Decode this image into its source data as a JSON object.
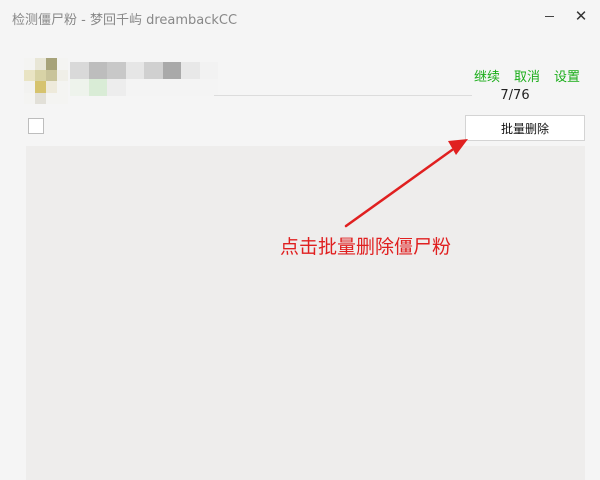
{
  "window": {
    "title": "检测僵尸粉 - 梦回千屿 dreambackCC",
    "close_glyph": "✕"
  },
  "profile": {
    "avatar_colors": [
      "#f4f4f2",
      "#e8e6d6",
      "#a7a37a",
      "#f4f4f2",
      "#e9e4c4",
      "#d8d3a6",
      "#c9c49a",
      "#f0efe8",
      "#f2f2f0",
      "#d6c36e",
      "#eeeadb",
      "#f4f4f2",
      "#f4f4f2",
      "#e2e0d8",
      "#f4f4f2",
      "#f4f4f2"
    ],
    "name_colors": [
      "#d9d9d9",
      "#bdbdbd",
      "#c8c8c8",
      "#e6e6e6",
      "#d0d0d0",
      "#a9a9a9",
      "#e8e8e8",
      "#f2f2f2",
      "#eef3ec",
      "#d9ecd6",
      "#ededed",
      "#f4f4f4",
      "#f4f4f4",
      "#f4f4f4",
      "#f4f4f4",
      "#f4f4f4"
    ]
  },
  "actions": {
    "continue_label": "继续",
    "cancel_label": "取消",
    "settings_label": "设置",
    "link_color": "#1aad19"
  },
  "progress": {
    "text": "7/76",
    "current": 7,
    "total": 76
  },
  "toolbar": {
    "bulk_delete_label": "批量删除",
    "select_all_checked": false
  },
  "annotation": {
    "text": "点击批量删除僵尸粉",
    "color": "#e02020"
  }
}
